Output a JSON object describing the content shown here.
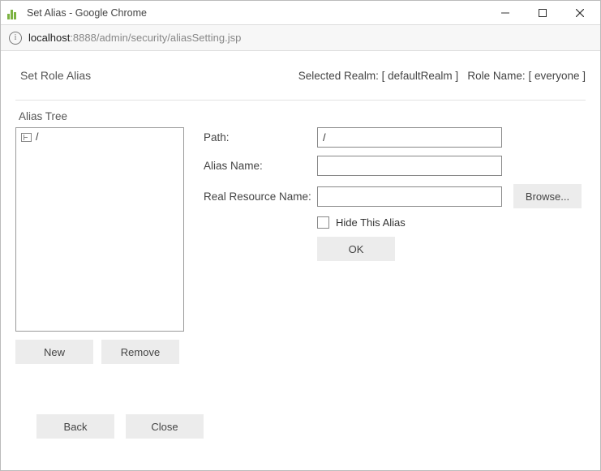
{
  "window": {
    "title": "Set Alias - Google Chrome"
  },
  "address": {
    "host": "localhost",
    "rest": ":8888/admin/security/aliasSetting.jsp"
  },
  "header": {
    "page_title": "Set Role Alias",
    "realm_label": "Selected Realm:",
    "realm_value": "[ defaultRealm ]",
    "role_label": "Role Name:",
    "role_value": "[ everyone ]"
  },
  "tree": {
    "section_label": "Alias Tree",
    "root": "/",
    "new_btn": "New",
    "remove_btn": "Remove"
  },
  "form": {
    "path_label": "Path:",
    "path_value": "/",
    "alias_label": "Alias Name:",
    "alias_value": "",
    "resource_label": "Real Resource Name:",
    "resource_value": "",
    "browse_btn": "Browse...",
    "hide_label": "Hide This Alias",
    "ok_btn": "OK"
  },
  "footer": {
    "back_btn": "Back",
    "close_btn": "Close"
  }
}
